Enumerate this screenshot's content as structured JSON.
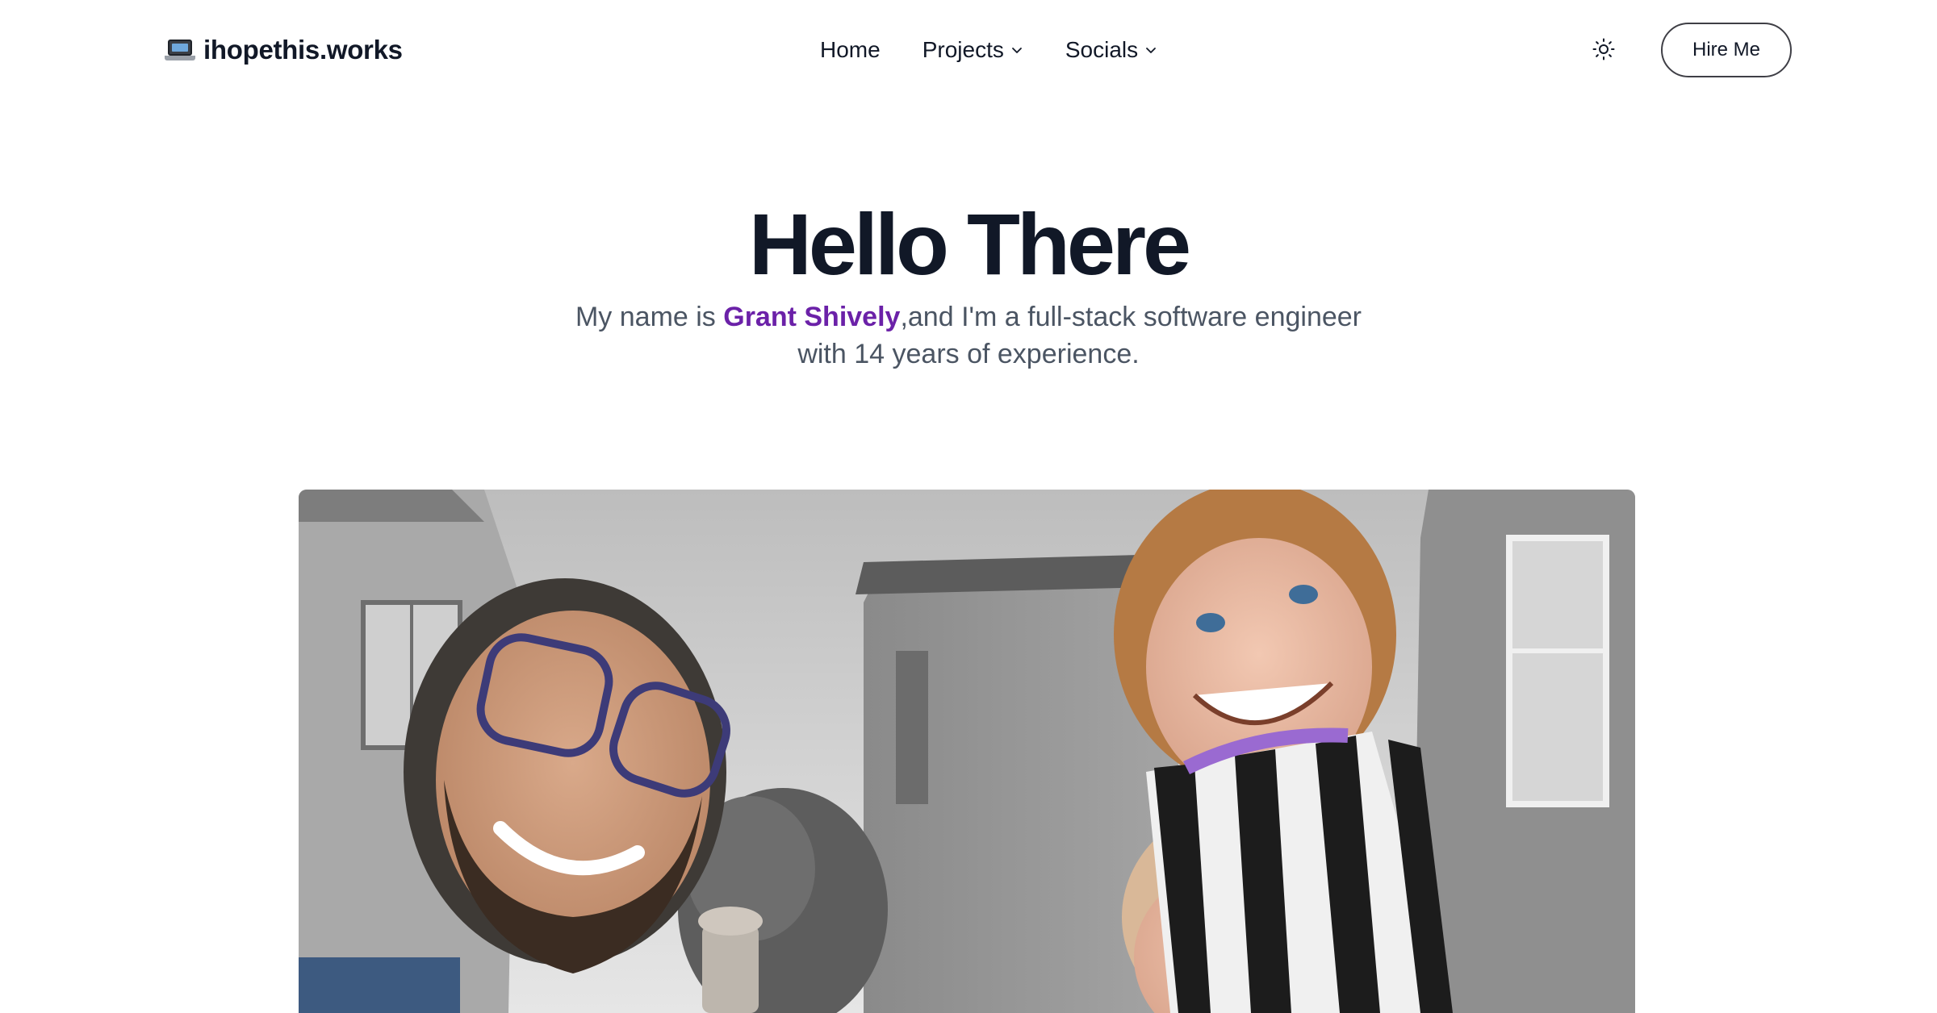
{
  "header": {
    "logo_icon": "laptop-icon",
    "logo_text": "ihopethis.works",
    "nav": [
      {
        "label": "Home",
        "has_dropdown": false
      },
      {
        "label": "Projects",
        "has_dropdown": true
      },
      {
        "label": "Socials",
        "has_dropdown": true
      }
    ],
    "theme_toggle_icon": "sun-icon",
    "cta_label": "Hire Me"
  },
  "hero": {
    "title": "Hello There",
    "intro_prefix": "My name is ",
    "name": "Grant Shively",
    "intro_suffix": ",and I'm a full-stack software engineer with 14 years of experience."
  },
  "colors": {
    "accent_name": "#6b21a8",
    "text_primary": "#111827",
    "text_secondary": "#4b5563"
  }
}
